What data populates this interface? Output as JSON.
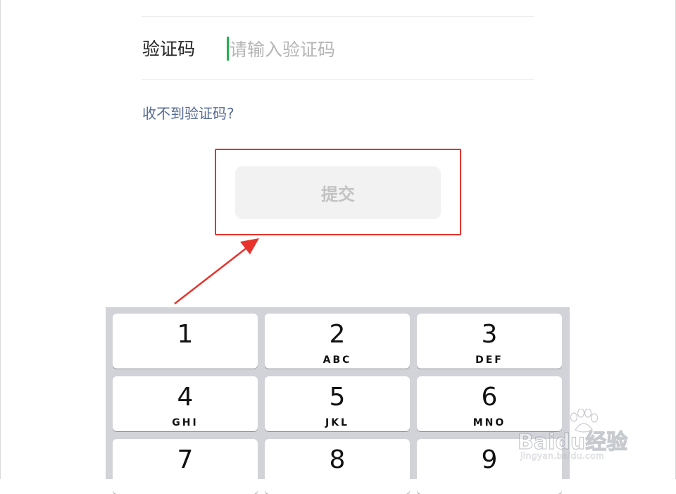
{
  "form": {
    "code_label": "验证码",
    "code_placeholder": "请输入验证码",
    "code_value": "",
    "help_link": "收不到验证码?",
    "submit_label": "提交"
  },
  "annotation": {
    "color": "#e8322c"
  },
  "keypad": {
    "keys": [
      {
        "digit": "1",
        "letters": ""
      },
      {
        "digit": "2",
        "letters": "ABC"
      },
      {
        "digit": "3",
        "letters": "DEF"
      },
      {
        "digit": "4",
        "letters": "GHI"
      },
      {
        "digit": "5",
        "letters": "JKL"
      },
      {
        "digit": "6",
        "letters": "MNO"
      },
      {
        "digit": "7",
        "letters": ""
      },
      {
        "digit": "8",
        "letters": ""
      },
      {
        "digit": "9",
        "letters": ""
      }
    ]
  },
  "watermark": {
    "brand": "Baidu经验",
    "url": "jingyan.baidu.com",
    "icon": "paw-icon"
  },
  "colors": {
    "link": "#576b95",
    "cursor": "#22b14c",
    "keypad_bg": "#d1d3d9",
    "button_disabled_bg": "#f2f2f2",
    "button_disabled_text": "#c2c2c2"
  }
}
